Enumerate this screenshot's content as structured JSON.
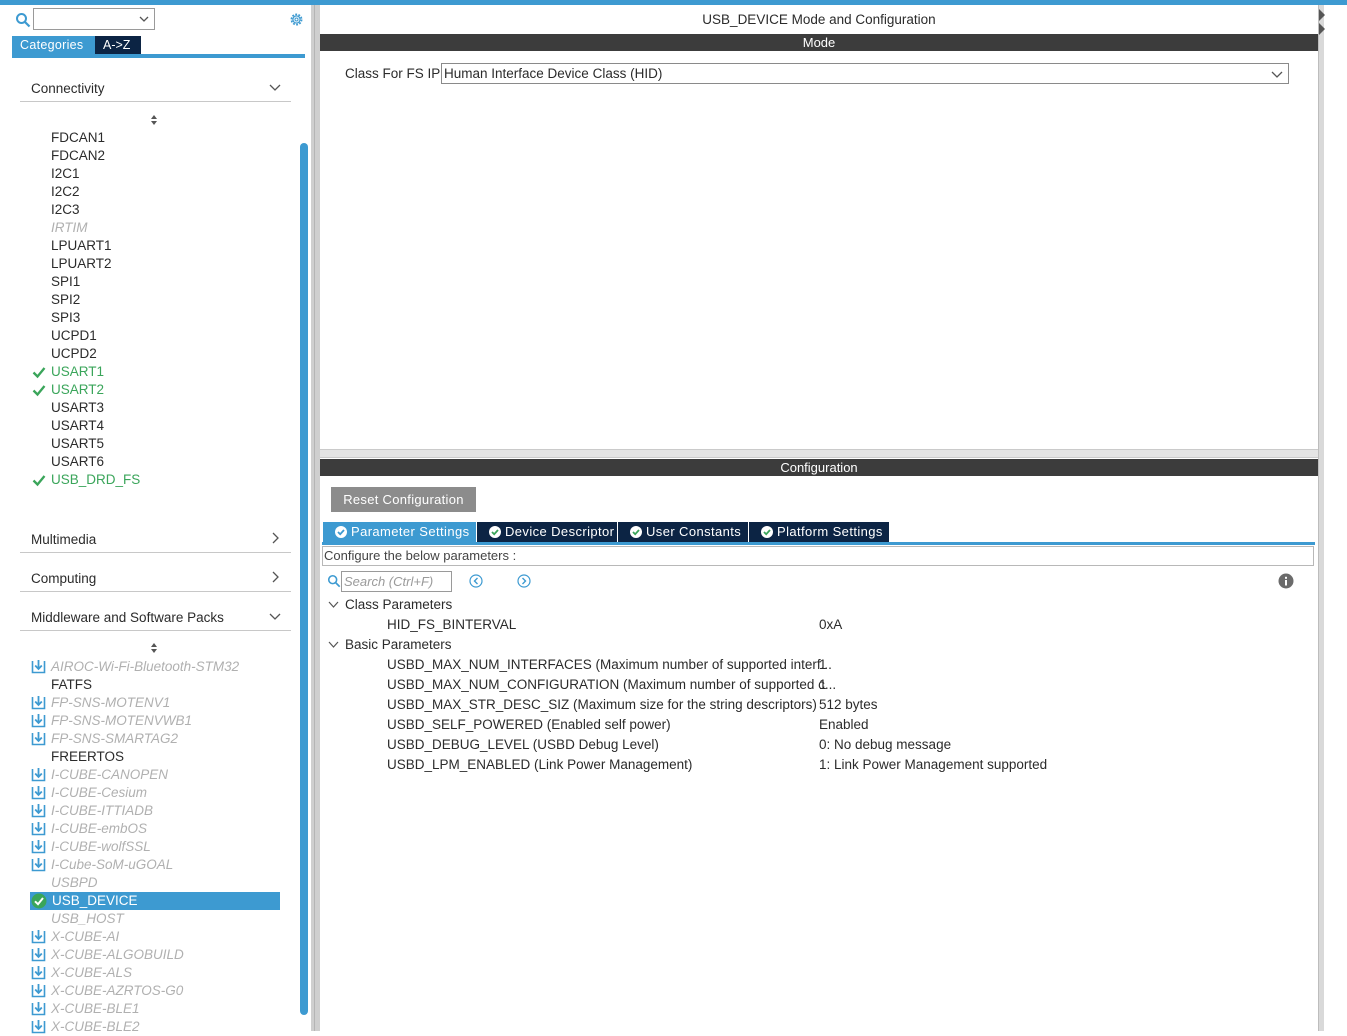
{
  "left": {
    "tabs": {
      "categories": "Categories",
      "az": "A->Z"
    },
    "sections": {
      "connectivity": "Connectivity",
      "multimedia": "Multimedia",
      "computing": "Computing",
      "middleware": "Middleware and Software Packs"
    },
    "connectivity_items": [
      {
        "label": "FDCAN1",
        "state": "normal"
      },
      {
        "label": "FDCAN2",
        "state": "normal"
      },
      {
        "label": "I2C1",
        "state": "normal"
      },
      {
        "label": "I2C2",
        "state": "normal"
      },
      {
        "label": "I2C3",
        "state": "normal"
      },
      {
        "label": "IRTIM",
        "state": "disabled"
      },
      {
        "label": "LPUART1",
        "state": "normal"
      },
      {
        "label": "LPUART2",
        "state": "normal"
      },
      {
        "label": "SPI1",
        "state": "normal"
      },
      {
        "label": "SPI2",
        "state": "normal"
      },
      {
        "label": "SPI3",
        "state": "normal"
      },
      {
        "label": "UCPD1",
        "state": "normal"
      },
      {
        "label": "UCPD2",
        "state": "normal"
      },
      {
        "label": "USART1",
        "state": "configured"
      },
      {
        "label": "USART2",
        "state": "configured"
      },
      {
        "label": "USART3",
        "state": "normal"
      },
      {
        "label": "USART4",
        "state": "normal"
      },
      {
        "label": "USART5",
        "state": "normal"
      },
      {
        "label": "USART6",
        "state": "normal"
      },
      {
        "label": "USB_DRD_FS",
        "state": "configured"
      }
    ],
    "middleware_items": [
      {
        "label": "AIROC-Wi-Fi-Bluetooth-STM32",
        "state": "download"
      },
      {
        "label": "FATFS",
        "state": "normal"
      },
      {
        "label": "FP-SNS-MOTENV1",
        "state": "download"
      },
      {
        "label": "FP-SNS-MOTENVWB1",
        "state": "download"
      },
      {
        "label": "FP-SNS-SMARTAG2",
        "state": "download"
      },
      {
        "label": "FREERTOS",
        "state": "normal"
      },
      {
        "label": "I-CUBE-CANOPEN",
        "state": "download"
      },
      {
        "label": "I-CUBE-Cesium",
        "state": "download"
      },
      {
        "label": "I-CUBE-ITTIADB",
        "state": "download"
      },
      {
        "label": "I-CUBE-embOS",
        "state": "download"
      },
      {
        "label": "I-CUBE-wolfSSL",
        "state": "download"
      },
      {
        "label": "I-Cube-SoM-uGOAL",
        "state": "download"
      },
      {
        "label": "USBPD",
        "state": "disabled"
      },
      {
        "label": "USB_DEVICE",
        "state": "selected"
      },
      {
        "label": "USB_HOST",
        "state": "disabled"
      },
      {
        "label": "X-CUBE-AI",
        "state": "download"
      },
      {
        "label": "X-CUBE-ALGOBUILD",
        "state": "download"
      },
      {
        "label": "X-CUBE-ALS",
        "state": "download"
      },
      {
        "label": "X-CUBE-AZRTOS-G0",
        "state": "download"
      },
      {
        "label": "X-CUBE-BLE1",
        "state": "download"
      },
      {
        "label": "X-CUBE-BLE2",
        "state": "download"
      }
    ]
  },
  "right": {
    "title": "USB_DEVICE Mode and Configuration",
    "mode_header": "Mode",
    "class_label": "Class For FS IP",
    "class_value": "Human Interface Device Class (HID)",
    "config_header": "Configuration",
    "reset_button": "Reset Configuration",
    "config_tabs": [
      "Parameter Settings",
      "Device Descriptor",
      "User Constants",
      "Platform Settings"
    ],
    "configure_text": "Configure the below parameters :",
    "search_placeholder": "Search (Ctrl+F)",
    "groups": [
      {
        "name": "Class Parameters",
        "params": [
          {
            "name": "HID_FS_BINTERVAL",
            "value": "0xA"
          }
        ]
      },
      {
        "name": "Basic Parameters",
        "params": [
          {
            "name": "USBD_MAX_NUM_INTERFACES (Maximum number of supported interf...",
            "value": "1"
          },
          {
            "name": "USBD_MAX_NUM_CONFIGURATION (Maximum number of supported c...",
            "value": "1"
          },
          {
            "name": "USBD_MAX_STR_DESC_SIZ (Maximum size for the string descriptors)",
            "value": "512 bytes"
          },
          {
            "name": "USBD_SELF_POWERED (Enabled self power)",
            "value": "Enabled"
          },
          {
            "name": "USBD_DEBUG_LEVEL (USBD Debug Level)",
            "value": "0: No debug message"
          },
          {
            "name": "USBD_LPM_ENABLED (Link Power Management)",
            "value": "1: Link Power Management supported"
          }
        ]
      }
    ]
  },
  "colors": {
    "accent": "#3d9ad1",
    "dark_tab": "#0c2444",
    "band": "#3c3c3c",
    "configured_green": "#3aa55a",
    "disabled_gray": "#b0b0b0"
  },
  "icons": [
    "search-icon",
    "gear-icon",
    "chevron-down-icon",
    "chevron-right-icon",
    "sort-arrow-icon",
    "check-icon",
    "download-icon",
    "info-icon",
    "prev-icon",
    "next-icon"
  ]
}
